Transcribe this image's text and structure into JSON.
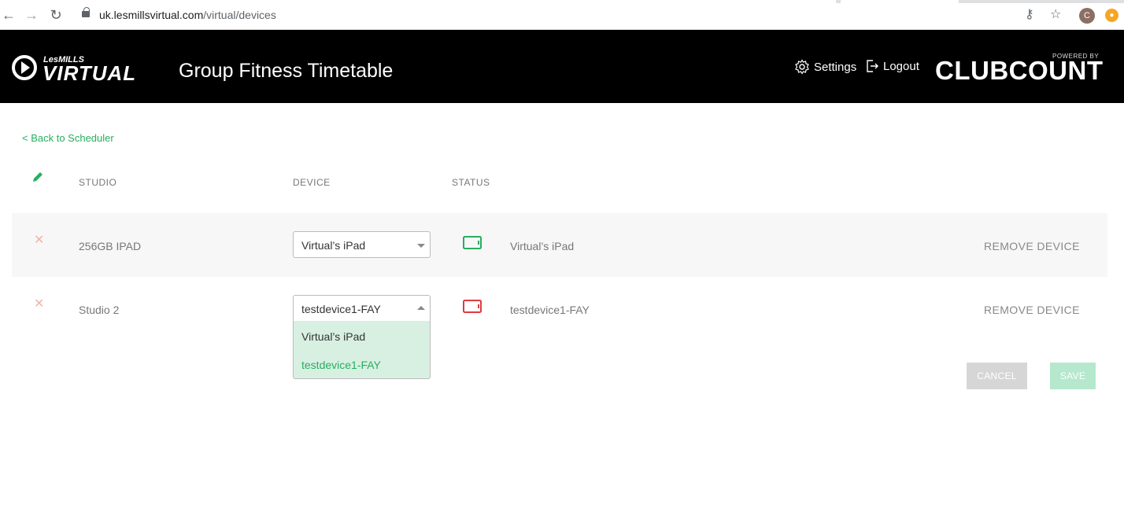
{
  "browser": {
    "url_host": "uk.lesmillsvirtual.com",
    "url_path": "/virtual/devices",
    "back_icon": "back-arrow-icon",
    "forward_icon": "forward-arrow-icon",
    "reload_icon": "reload-icon",
    "avatar_initial": "C"
  },
  "header": {
    "logo_small": "LesMILLS",
    "logo_big": "VIRTUAL",
    "title": "Group Fitness Timetable",
    "settings_label": "Settings",
    "logout_label": "Logout",
    "powered_by": "POWERED BY",
    "brand": "CLUBCOUNT"
  },
  "page": {
    "back_link": "< Back to Scheduler",
    "columns": {
      "studio": "STUDIO",
      "device": "DEVICE",
      "status": "STATUS"
    }
  },
  "rows": [
    {
      "studio": "256GB IPAD",
      "device": "Virtual’s iPad",
      "status_text": "Virtual’s iPad",
      "status_color": "#27ae60",
      "remove": "REMOVE DEVICE"
    },
    {
      "studio": "Studio 2",
      "device": "testdevice1-FAY",
      "status_text": "testdevice1-FAY",
      "status_color": "#e03a3e",
      "remove": "REMOVE DEVICE"
    }
  ],
  "dropdown": {
    "options": [
      {
        "label": "Virtual’s iPad",
        "color": "#333333"
      },
      {
        "label": "testdevice1-FAY",
        "color": "#27ae60"
      }
    ]
  },
  "actions": {
    "cancel": "CANCEL",
    "save": "SAVE"
  },
  "colors": {
    "accent": "#27ae60",
    "header_bg": "#000000",
    "error": "#e03a3e"
  }
}
